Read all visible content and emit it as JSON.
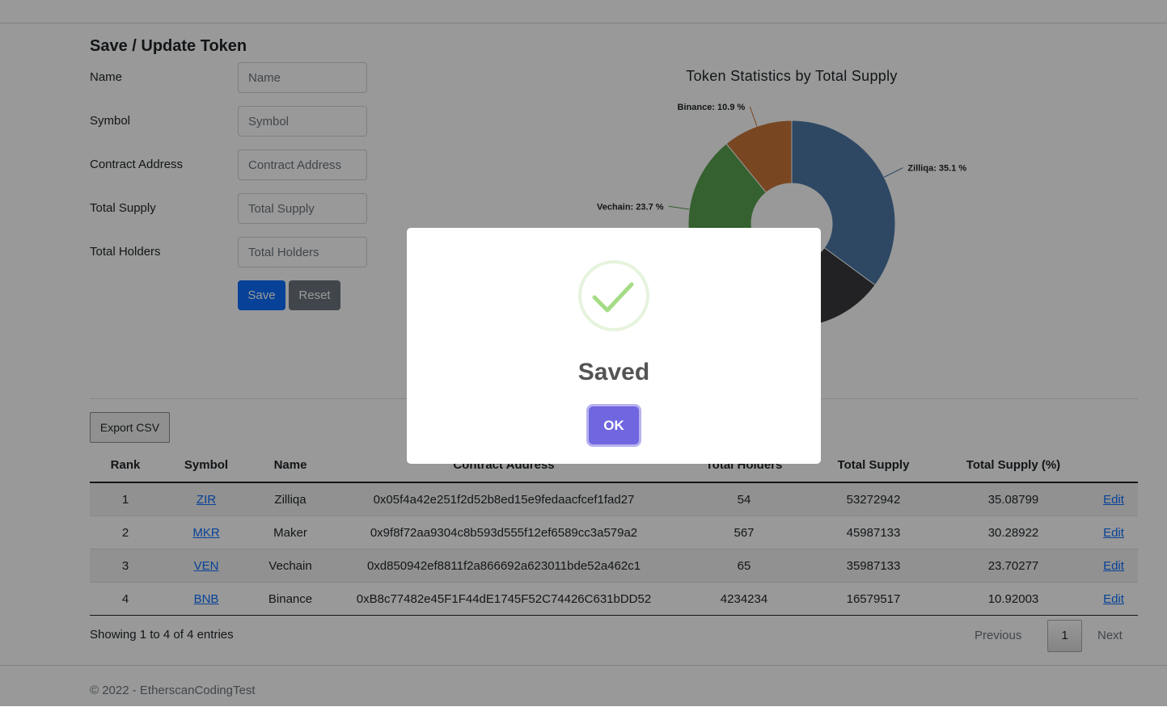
{
  "form": {
    "title": "Save / Update Token",
    "fields": [
      {
        "label": "Name",
        "placeholder": "Name"
      },
      {
        "label": "Symbol",
        "placeholder": "Symbol"
      },
      {
        "label": "Contract Address",
        "placeholder": "Contract Address"
      },
      {
        "label": "Total Supply",
        "placeholder": "Total Supply"
      },
      {
        "label": "Total Holders",
        "placeholder": "Total Holders"
      }
    ],
    "save_label": "Save",
    "reset_label": "Reset"
  },
  "chart_data": {
    "type": "pie",
    "title": "Token Statistics by Total Supply",
    "slices": [
      {
        "name": "Zilliqa",
        "value": 35.1,
        "label": "Zilliqa: 35.1 %",
        "color": "#4e79a7"
      },
      {
        "name": "Maker",
        "value": 30.3,
        "label": "",
        "color": "#3a3a3c"
      },
      {
        "name": "Vechain",
        "value": 23.7,
        "label": "Vechain: 23.7 %",
        "color": "#59a14f"
      },
      {
        "name": "Binance",
        "value": 10.9,
        "label": "Binance: 10.9 %",
        "color": "#c9773a"
      }
    ]
  },
  "toolbar": {
    "export_label": "Export CSV"
  },
  "table": {
    "headers": [
      "Rank",
      "Symbol",
      "Name",
      "Contract Address",
      "Total Holders",
      "Total Supply",
      "Total Supply (%)",
      ""
    ],
    "rows": [
      {
        "rank": "1",
        "symbol": "ZIR",
        "name": "Zilliqa",
        "address": "0x05f4a42e251f2d52b8ed15e9fedaacfcef1fad27",
        "holders": "54",
        "supply": "53272942",
        "percent": "35.08799",
        "edit": "Edit"
      },
      {
        "rank": "2",
        "symbol": "MKR",
        "name": "Maker",
        "address": "0x9f8f72aa9304c8b593d555f12ef6589cc3a579a2",
        "holders": "567",
        "supply": "45987133",
        "percent": "30.28922",
        "edit": "Edit"
      },
      {
        "rank": "3",
        "symbol": "VEN",
        "name": "Vechain",
        "address": "0xd850942ef8811f2a866692a623011bde52a462c1",
        "holders": "65",
        "supply": "35987133",
        "percent": "23.70277",
        "edit": "Edit"
      },
      {
        "rank": "4",
        "symbol": "BNB",
        "name": "Binance",
        "address": "0xB8c77482e45F1F44dE1745F52C74426C631bDD52",
        "holders": "4234234",
        "supply": "16579517",
        "percent": "10.92003",
        "edit": "Edit"
      }
    ]
  },
  "pagination": {
    "info": "Showing 1 to 4 of 4 entries",
    "previous": "Previous",
    "page": "1",
    "next": "Next"
  },
  "footer": {
    "text": "© 2022 - EtherscanCodingTest"
  },
  "modal": {
    "icon": "success-check-icon",
    "title": "Saved",
    "ok_label": "OK"
  },
  "colors": {
    "primary": "#0d6efd",
    "secondary": "#6c757d",
    "modal_button": "#7066e0",
    "success": "#a5dc86"
  }
}
